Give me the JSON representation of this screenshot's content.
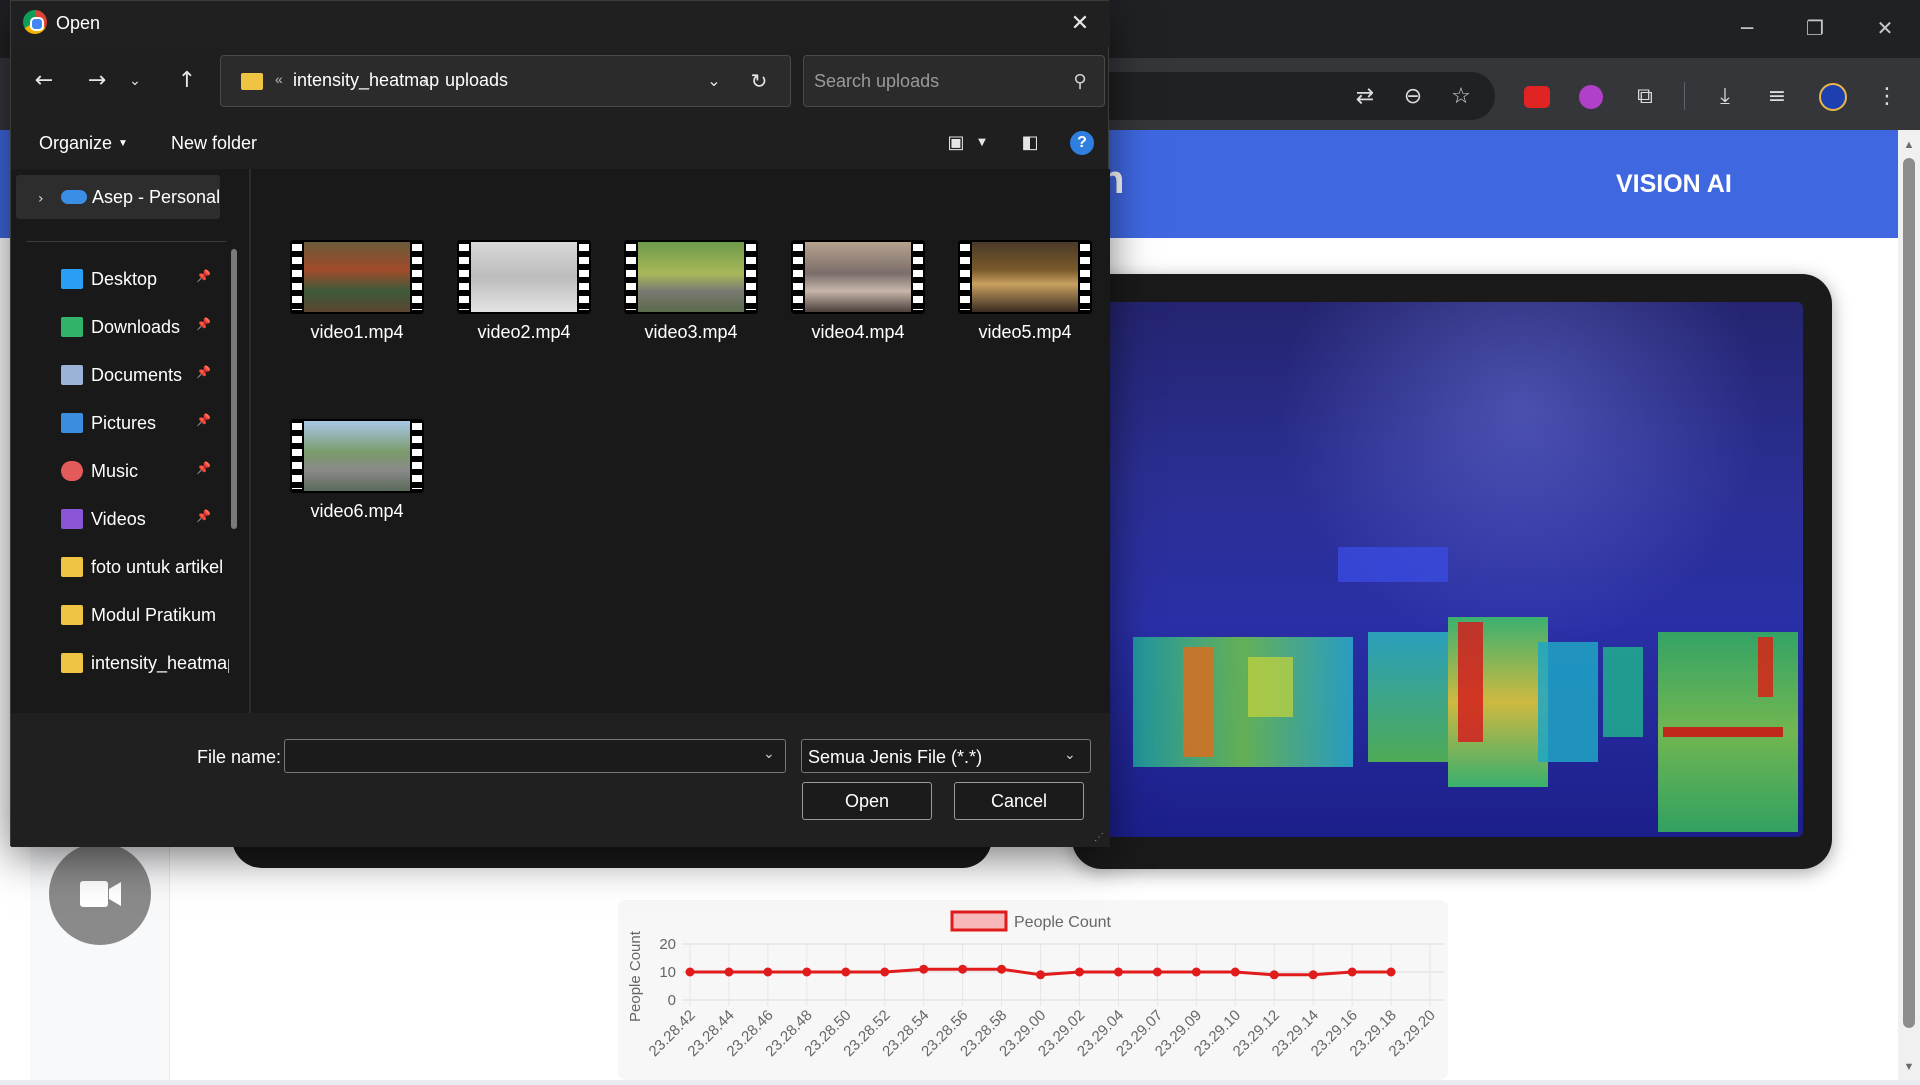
{
  "browser": {
    "header_title": "VISION AI",
    "header_fragment": "n",
    "toolbar_icons": [
      "translate-icon",
      "zoom-out-icon",
      "star-icon",
      "extension-red-icon",
      "extension-purple-icon",
      "puzzle-icon",
      "download-icon",
      "media-icon",
      "profile-avatar",
      "more-icon"
    ],
    "window_controls": {
      "minimize": "─",
      "restore": "❐",
      "close": "✕"
    }
  },
  "chart": {
    "legend": "People Count",
    "ylabel": "People Count",
    "y_ticks": [
      "20",
      "10",
      "0"
    ]
  },
  "chart_data": {
    "type": "line",
    "title": "",
    "xlabel": "",
    "ylabel": "People Count",
    "ylim": [
      0,
      20
    ],
    "categories": [
      "23.28.42",
      "23.28.44",
      "23.28.46",
      "23.28.48",
      "23.28.50",
      "23.28.52",
      "23.28.54",
      "23.28.56",
      "23.28.58",
      "23.29.00",
      "23.29.02",
      "23.29.04",
      "23.29.07",
      "23.29.09",
      "23.29.10",
      "23.29.12",
      "23.29.14",
      "23.29.16",
      "23.29.18",
      "23.29.20"
    ],
    "series": [
      {
        "name": "People Count",
        "color": "#e01b1b",
        "values": [
          10,
          10,
          10,
          10,
          10,
          10,
          11,
          11,
          11,
          9,
          10,
          10,
          10,
          10,
          10,
          9,
          9,
          10,
          10,
          null
        ]
      }
    ],
    "legend_position": "top",
    "grid": true
  },
  "dialog": {
    "title": "Open",
    "breadcrumb": {
      "overflow": "«",
      "items": [
        "intensity_heatmap",
        "uploads"
      ],
      "separator": "›"
    },
    "search_placeholder": "Search uploads",
    "commands": {
      "organize": "Organize",
      "new_folder": "New folder"
    },
    "nav": {
      "onedrive": "Asep - Personal",
      "items": [
        {
          "label": "Desktop",
          "icon": "desktop-icon",
          "color": "#2a9df4",
          "pinned": true
        },
        {
          "label": "Downloads",
          "icon": "download-arrow-icon",
          "color": "#32b36a",
          "pinned": true
        },
        {
          "label": "Documents",
          "icon": "document-icon",
          "color": "#9bb3d6",
          "pinned": true
        },
        {
          "label": "Pictures",
          "icon": "picture-icon",
          "color": "#3b8de0",
          "pinned": true
        },
        {
          "label": "Music",
          "icon": "music-icon",
          "color": "#e35a5a",
          "pinned": true
        },
        {
          "label": "Videos",
          "icon": "video-icon",
          "color": "#8a54d6",
          "pinned": true
        },
        {
          "label": "foto untuk artikel",
          "icon": "folder-icon",
          "color": "#f0c443",
          "pinned": false
        },
        {
          "label": "Modul Pratikum",
          "icon": "folder-icon",
          "color": "#f0c443",
          "pinned": false
        },
        {
          "label": "intensity_heatmap",
          "icon": "folder-icon",
          "color": "#f0c443",
          "pinned": false
        }
      ]
    },
    "files": [
      "video1.mp4",
      "video2.mp4",
      "video3.mp4",
      "video4.mp4",
      "video5.mp4",
      "video6.mp4"
    ],
    "file_name_label": "File name:",
    "file_name_value": "",
    "file_type": "Semua Jenis File (*.*)",
    "open_button": "Open",
    "cancel_button": "Cancel"
  }
}
